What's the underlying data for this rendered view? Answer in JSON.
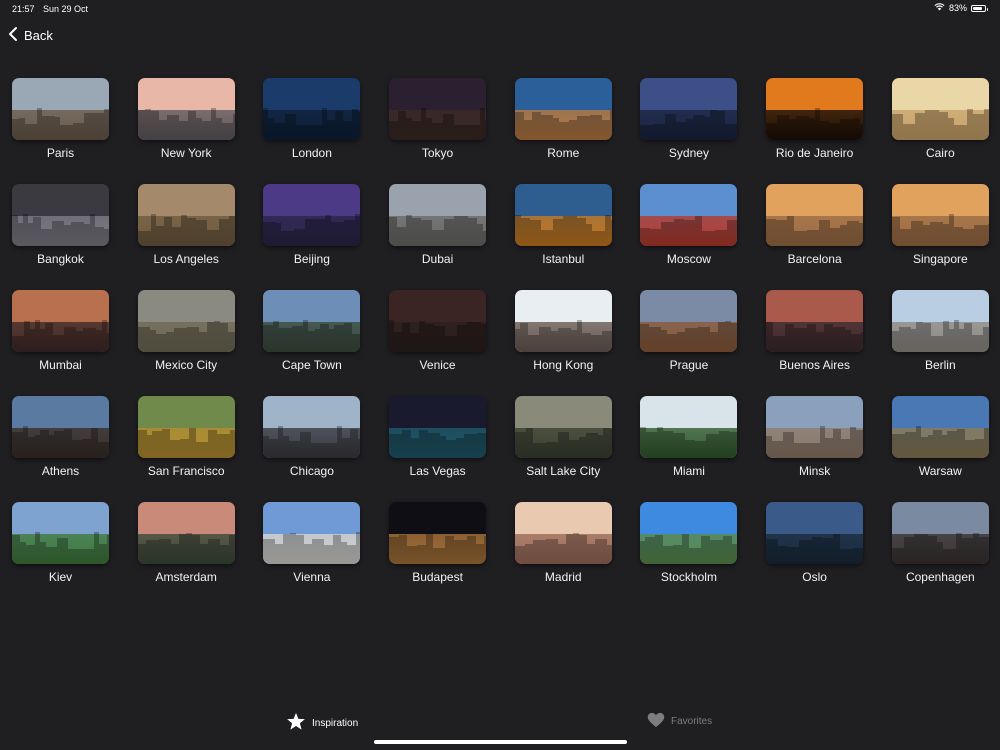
{
  "status": {
    "time": "21:57",
    "date": "Sun 29 Oct",
    "battery": "83%",
    "battery_level": 0.83
  },
  "nav": {
    "back_label": "Back"
  },
  "cities": [
    {
      "name": "Paris",
      "sky": "#9aa7b5",
      "ground": "#6b5a4a"
    },
    {
      "name": "New York",
      "sky": "#e8b7a8",
      "ground": "#5f5a5e"
    },
    {
      "name": "London",
      "sky": "#1b3c6a",
      "ground": "#0f2038"
    },
    {
      "name": "Tokyo",
      "sky": "#2a2030",
      "ground": "#3b2a25"
    },
    {
      "name": "Rome",
      "sky": "#2b5f9a",
      "ground": "#b7793f"
    },
    {
      "name": "Sydney",
      "sky": "#3c4f86",
      "ground": "#1b2440"
    },
    {
      "name": "Rio de Janeiro",
      "sky": "#e07a1c",
      "ground": "#1a0f08"
    },
    {
      "name": "Cairo",
      "sky": "#e9d7a8",
      "ground": "#c9a26a"
    },
    {
      "name": "Bangkok",
      "sky": "#3a3a40",
      "ground": "#7d7c85"
    },
    {
      "name": "Los Angeles",
      "sky": "#a48a6a",
      "ground": "#6e5a3f"
    },
    {
      "name": "Beijing",
      "sky": "#4c3a86",
      "ground": "#2b2548"
    },
    {
      "name": "Dubai",
      "sky": "#9aa3ad",
      "ground": "#6a6a66"
    },
    {
      "name": "Istanbul",
      "sky": "#2e5e8f",
      "ground": "#c7791f"
    },
    {
      "name": "Moscow",
      "sky": "#5b8fd0",
      "ground": "#b53a2c"
    },
    {
      "name": "Barcelona",
      "sky": "#e0a25d",
      "ground": "#9a6b45"
    },
    {
      "name": "Singapore",
      "sky": "#e0a25d",
      "ground": "#9a6b45"
    },
    {
      "name": "Mumbai",
      "sky": "#b8704e",
      "ground": "#3f2a2a"
    },
    {
      "name": "Mexico City",
      "sky": "#8a8a80",
      "ground": "#6f6a55"
    },
    {
      "name": "Cape Town",
      "sky": "#6d8fb7",
      "ground": "#3b4b3a"
    },
    {
      "name": "Venice",
      "sky": "#3a2524",
      "ground": "#2b1f1e"
    },
    {
      "name": "Hong Kong",
      "sky": "#e9eef2",
      "ground": "#6a5a52"
    },
    {
      "name": "Prague",
      "sky": "#7b8aa5",
      "ground": "#8a5a3a"
    },
    {
      "name": "Buenos Aires",
      "sky": "#a95a4a",
      "ground": "#3b2a30"
    },
    {
      "name": "Berlin",
      "sky": "#b9cde3",
      "ground": "#8f8a82"
    },
    {
      "name": "Athens",
      "sky": "#5a7aa2",
      "ground": "#3a2e25"
    },
    {
      "name": "San Francisco",
      "sky": "#6f8a4a",
      "ground": "#b58c30"
    },
    {
      "name": "Chicago",
      "sky": "#9fb3c9",
      "ground": "#3a3a40"
    },
    {
      "name": "Las Vegas",
      "sky": "#1a1a2e",
      "ground": "#1f5a6a"
    },
    {
      "name": "Salt Lake City",
      "sky": "#8a8a7a",
      "ground": "#3a4030"
    },
    {
      "name": "Miami",
      "sky": "#d8e3ea",
      "ground": "#2f5a2a"
    },
    {
      "name": "Minsk",
      "sky": "#8aa0bd",
      "ground": "#8f7a68"
    },
    {
      "name": "Warsaw",
      "sky": "#4a78b5",
      "ground": "#8a7a55"
    },
    {
      "name": "Kiev",
      "sky": "#7fa3d0",
      "ground": "#3f7a3a"
    },
    {
      "name": "Amsterdam",
      "sky": "#c98a7a",
      "ground": "#3a4a3a"
    },
    {
      "name": "Vienna",
      "sky": "#6f9ad6",
      "ground": "#d6d3cc"
    },
    {
      "name": "Budapest",
      "sky": "#0e0e14",
      "ground": "#a8733a"
    },
    {
      "name": "Madrid",
      "sky": "#e9c9b0",
      "ground": "#9a6a58"
    },
    {
      "name": "Stockholm",
      "sky": "#3e8ae0",
      "ground": "#5a8a4a"
    },
    {
      "name": "Oslo",
      "sky": "#3a5a8a",
      "ground": "#1a2a3a"
    },
    {
      "name": "Copenhagen",
      "sky": "#7a8aa0",
      "ground": "#3a3230"
    }
  ],
  "tabs": [
    {
      "label": "Inspiration",
      "icon": "star-icon",
      "selected": true
    },
    {
      "label": "Favorites",
      "icon": "heart-icon",
      "selected": false
    }
  ]
}
